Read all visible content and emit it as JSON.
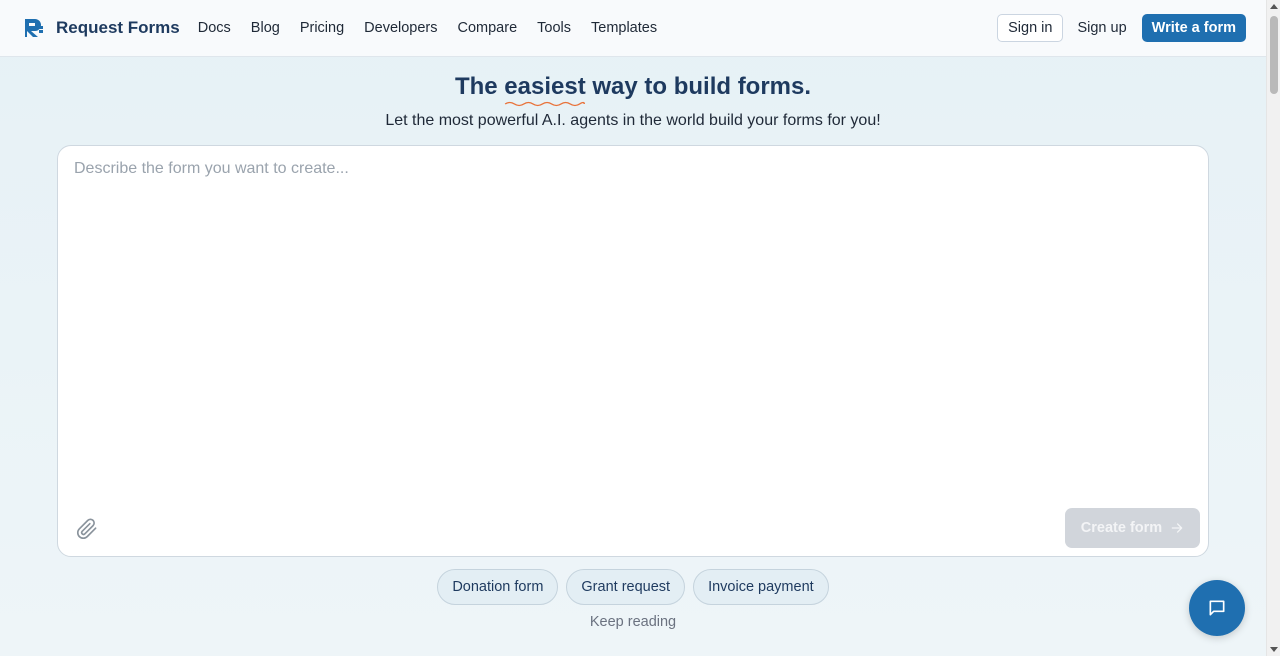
{
  "header": {
    "brand": "Request Forms",
    "nav": [
      "Docs",
      "Blog",
      "Pricing",
      "Developers",
      "Compare",
      "Tools",
      "Templates"
    ],
    "sign_in": "Sign in",
    "sign_up": "Sign up",
    "write_form": "Write a form"
  },
  "hero": {
    "title_before": "The ",
    "title_emph": "easiest",
    "title_after": " way to build forms.",
    "subtitle": "Let the most powerful A.I. agents in the world build your forms for you!"
  },
  "composer": {
    "placeholder": "Describe the form you want to create...",
    "value": "",
    "create_label": "Create form"
  },
  "suggestions": [
    "Donation form",
    "Grant request",
    "Invoice payment"
  ],
  "keep_reading": "Keep reading",
  "colors": {
    "brand_blue": "#1f6fb0",
    "heading": "#1e3a5f",
    "squiggle": "#e8733a",
    "disabled_button": "#d1d5db"
  },
  "icons": {
    "logo": "request-forms-logo",
    "attach": "paperclip-icon",
    "create_arrow": "arrow-right-icon",
    "chat": "chat-bubble-icon"
  }
}
